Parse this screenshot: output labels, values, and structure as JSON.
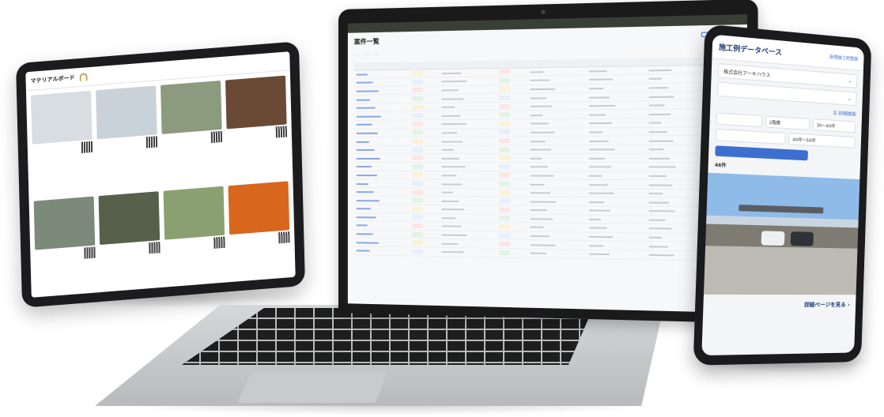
{
  "tablet": {
    "brand": "マテリアルボード",
    "header_sub": [
      "",
      ""
    ],
    "header_right": [
      "",
      ""
    ],
    "cards": [
      {
        "caption": "",
        "meta": "",
        "color": "#d8dde2"
      },
      {
        "caption": "",
        "meta": "",
        "color": "#c9d2d8"
      },
      {
        "caption": "",
        "meta": "",
        "color": "#8c9a7e"
      },
      {
        "caption": "",
        "meta": "",
        "color": "#6b4a35"
      },
      {
        "caption": "",
        "meta": "",
        "color": "#7c8a79"
      },
      {
        "caption": "",
        "meta": "",
        "color": "#56604b"
      },
      {
        "caption": "",
        "meta": "",
        "color": "#8aa071"
      },
      {
        "caption": "",
        "meta": "",
        "color": "#d9661d"
      }
    ]
  },
  "laptop": {
    "topbar_left": "",
    "topbar_right": [
      "",
      ""
    ],
    "title": "案件一覧",
    "buttons": [
      "",
      "",
      ""
    ],
    "filter_chips": [
      "",
      "",
      ""
    ],
    "columns": [
      "",
      "",
      "",
      "",
      "",
      "",
      "",
      ""
    ],
    "rows_count": 22,
    "pager": ""
  },
  "phone": {
    "title": "施工例データベース",
    "link": "新規施工例登録",
    "company": "株式会社アーキハウス",
    "placeholder": "",
    "detail_link": "詳細検索",
    "selects": [
      "",
      "2階建",
      "30〜40坪"
    ],
    "selects2": [
      "",
      "40坪〜50坪"
    ],
    "search_label": "",
    "count": "46件",
    "more_link": "詳細ページを見る ›"
  }
}
